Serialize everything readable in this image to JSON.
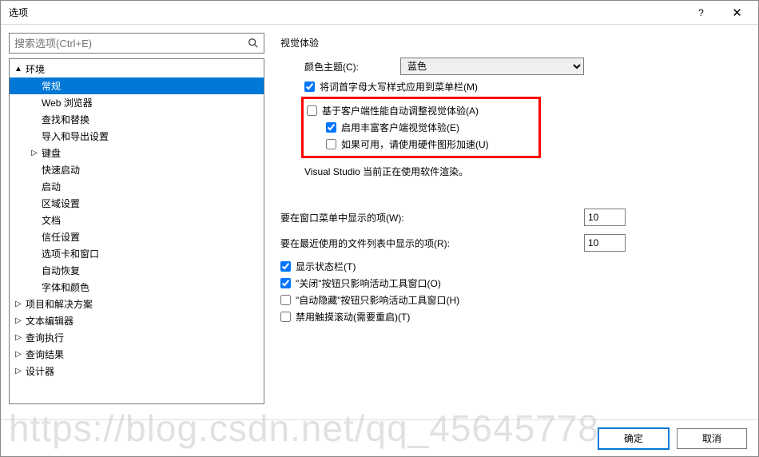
{
  "window": {
    "title": "选项"
  },
  "search": {
    "placeholder": "搜索选项(Ctrl+E)"
  },
  "tree": {
    "items": [
      {
        "label": "环境",
        "indent": 0,
        "arrow": "▲",
        "selected": false
      },
      {
        "label": "常规",
        "indent": 1,
        "arrow": "",
        "selected": true
      },
      {
        "label": "Web 浏览器",
        "indent": 1,
        "arrow": "",
        "selected": false
      },
      {
        "label": "查找和替换",
        "indent": 1,
        "arrow": "",
        "selected": false
      },
      {
        "label": "导入和导出设置",
        "indent": 1,
        "arrow": "",
        "selected": false
      },
      {
        "label": "键盘",
        "indent": 1,
        "arrow": "▷",
        "selected": false
      },
      {
        "label": "快速启动",
        "indent": 1,
        "arrow": "",
        "selected": false
      },
      {
        "label": "启动",
        "indent": 1,
        "arrow": "",
        "selected": false
      },
      {
        "label": "区域设置",
        "indent": 1,
        "arrow": "",
        "selected": false
      },
      {
        "label": "文档",
        "indent": 1,
        "arrow": "",
        "selected": false
      },
      {
        "label": "信任设置",
        "indent": 1,
        "arrow": "",
        "selected": false
      },
      {
        "label": "选项卡和窗口",
        "indent": 1,
        "arrow": "",
        "selected": false
      },
      {
        "label": "自动恢复",
        "indent": 1,
        "arrow": "",
        "selected": false
      },
      {
        "label": "字体和颜色",
        "indent": 1,
        "arrow": "",
        "selected": false
      },
      {
        "label": "项目和解决方案",
        "indent": 0,
        "arrow": "▷",
        "selected": false
      },
      {
        "label": "文本编辑器",
        "indent": 0,
        "arrow": "▷",
        "selected": false
      },
      {
        "label": "查询执行",
        "indent": 0,
        "arrow": "▷",
        "selected": false
      },
      {
        "label": "查询结果",
        "indent": 0,
        "arrow": "▷",
        "selected": false
      },
      {
        "label": "设计器",
        "indent": 0,
        "arrow": "▷",
        "selected": false
      }
    ]
  },
  "panel": {
    "visual_experience": "视觉体验",
    "color_theme_label": "颜色主题(C):",
    "color_theme_value": "蓝色",
    "cb_title_case": "将词首字母大写样式应用到菜单栏(M)",
    "cb_auto_adjust": "基于客户端性能自动调整视觉体验(A)",
    "cb_rich_client": "启用丰富客户端视觉体验(E)",
    "cb_hw_accel": "如果可用，请使用硬件图形加速(U)",
    "status_text": "Visual Studio 当前正在使用软件渲染。",
    "window_menu_label": "要在窗口菜单中显示的项(W):",
    "window_menu_value": "10",
    "recent_files_label": "要在最近使用的文件列表中显示的项(R):",
    "recent_files_value": "10",
    "cb_statusbar": "显示状态栏(T)",
    "cb_close_active": "\"关闭\"按钮只影响活动工具窗口(O)",
    "cb_autohide_active": "\"自动隐藏\"按钮只影响活动工具窗口(H)",
    "cb_disable_touch": "禁用触摸滚动(需要重启)(T)"
  },
  "footer": {
    "ok": "确定",
    "cancel": "取消"
  },
  "watermark": "https://blog.csdn.net/qq_45645778"
}
